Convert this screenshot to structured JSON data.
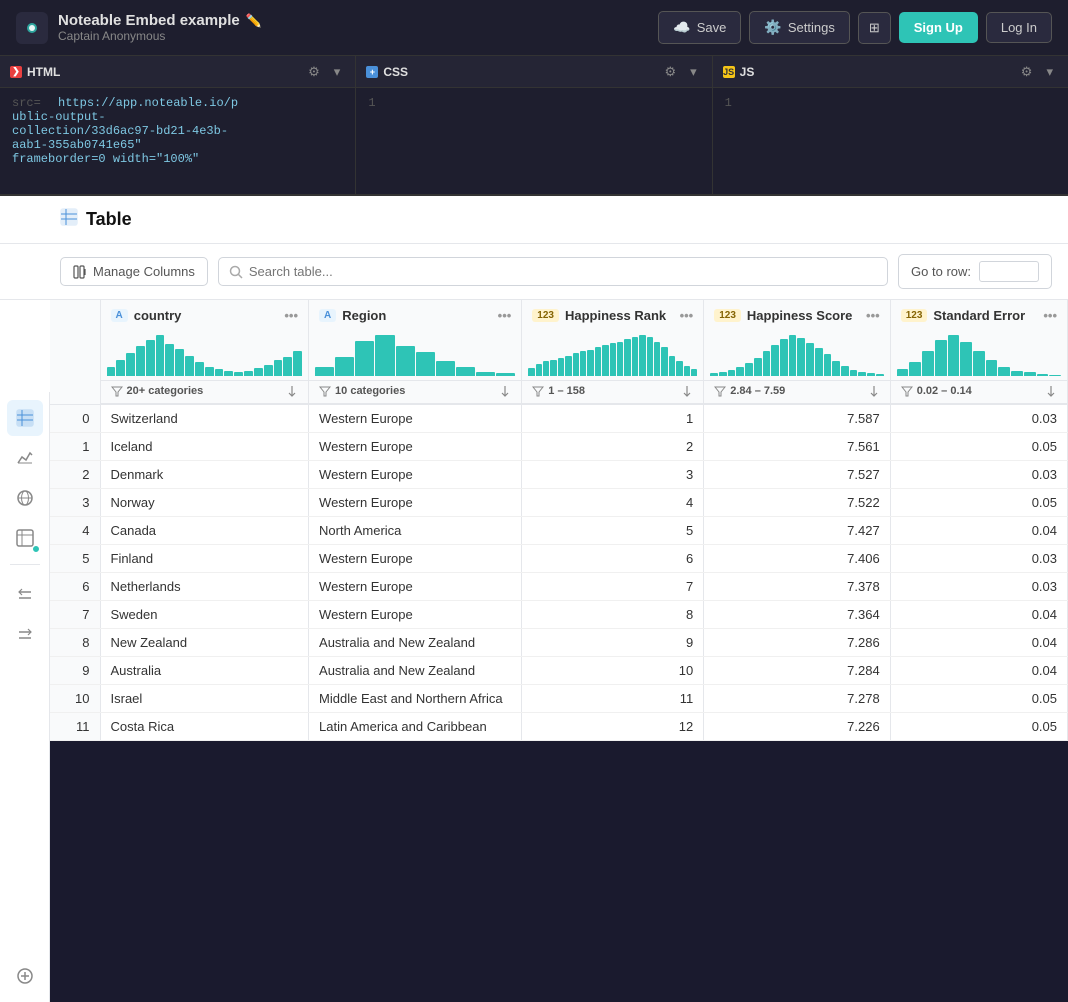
{
  "header": {
    "title": "Noteable Embed example",
    "subtitle": "Captain Anonymous",
    "buttons": {
      "save": "Save",
      "settings": "Settings",
      "signup": "Sign Up",
      "login": "Log In"
    }
  },
  "editor": {
    "panels": [
      {
        "lang": "HTML",
        "dot_type": "html",
        "lines": [
          "src= https://app.noteable.io/p",
          "ublic-output-",
          "collection/33d6ac97-bd21-4e3b-",
          "aab1-355ab0741e65\"",
          "frameborder=0 width=\"100%\""
        ]
      },
      {
        "lang": "CSS",
        "dot_type": "css",
        "lines": [
          "1"
        ]
      },
      {
        "lang": "JS",
        "dot_type": "js",
        "lines": [
          "1"
        ]
      }
    ]
  },
  "table": {
    "title": "Table",
    "manage_cols_label": "Manage Columns",
    "search_placeholder": "Search table...",
    "goto_row_label": "Go to row:",
    "columns": [
      {
        "type": "A",
        "name": "country",
        "type_class": "text",
        "stats": "20+ categories"
      },
      {
        "type": "A",
        "name": "Region",
        "type_class": "text",
        "stats": "10 categories"
      },
      {
        "type": "123",
        "name": "Happiness Rank",
        "type_class": "num",
        "stats": "1 – 158"
      },
      {
        "type": "123",
        "name": "Happiness Score",
        "type_class": "num",
        "stats": "2.84 – 7.59"
      },
      {
        "type": "123",
        "name": "Standard Error",
        "type_class": "num",
        "stats": "0.02 – 0.14"
      }
    ],
    "rows": [
      {
        "index": 0,
        "country": "Switzerland",
        "region": "Western Europe",
        "rank": 1,
        "score": 7.587,
        "stderr": 0.03
      },
      {
        "index": 1,
        "country": "Iceland",
        "region": "Western Europe",
        "rank": 2,
        "score": 7.561,
        "stderr": 0.05
      },
      {
        "index": 2,
        "country": "Denmark",
        "region": "Western Europe",
        "rank": 3,
        "score": 7.527,
        "stderr": 0.03
      },
      {
        "index": 3,
        "country": "Norway",
        "region": "Western Europe",
        "rank": 4,
        "score": 7.522,
        "stderr": 0.05
      },
      {
        "index": 4,
        "country": "Canada",
        "region": "North America",
        "rank": 5,
        "score": 7.427,
        "stderr": 0.04
      },
      {
        "index": 5,
        "country": "Finland",
        "region": "Western Europe",
        "rank": 6,
        "score": 7.406,
        "stderr": 0.03
      },
      {
        "index": 6,
        "country": "Netherlands",
        "region": "Western Europe",
        "rank": 7,
        "score": 7.378,
        "stderr": 0.03
      },
      {
        "index": 7,
        "country": "Sweden",
        "region": "Western Europe",
        "rank": 8,
        "score": 7.364,
        "stderr": 0.04
      },
      {
        "index": 8,
        "country": "New Zealand",
        "region": "Australia and New Zealand",
        "rank": 9,
        "score": 7.286,
        "stderr": 0.04
      },
      {
        "index": 9,
        "country": "Australia",
        "region": "Australia and New Zealand",
        "rank": 10,
        "score": 7.284,
        "stderr": 0.04
      },
      {
        "index": 10,
        "country": "Israel",
        "region": "Middle East and Northern Africa",
        "rank": 11,
        "score": 7.278,
        "stderr": 0.05
      },
      {
        "index": 11,
        "country": "Costa Rica",
        "region": "Latin America and Caribbean",
        "rank": 12,
        "score": 7.226,
        "stderr": 0.05
      }
    ],
    "histograms": {
      "country": [
        20,
        35,
        50,
        65,
        80,
        90,
        70,
        60,
        45,
        30,
        20,
        15,
        10,
        8,
        12,
        18,
        25,
        35,
        42,
        55
      ],
      "region": [
        20,
        45,
        80,
        95,
        70,
        55,
        35,
        20,
        10,
        8
      ],
      "rank": [
        10,
        15,
        18,
        20,
        22,
        25,
        28,
        30,
        32,
        35,
        38,
        40,
        42,
        45,
        48,
        50,
        48,
        42,
        35,
        25,
        18,
        12,
        8
      ],
      "score": [
        5,
        8,
        12,
        18,
        25,
        35,
        48,
        60,
        72,
        80,
        75,
        65,
        55,
        42,
        30,
        20,
        12,
        8,
        5,
        3
      ],
      "stderr": [
        15,
        30,
        55,
        80,
        90,
        75,
        55,
        35,
        20,
        12,
        8,
        5,
        3
      ]
    }
  },
  "sidebar": {
    "items": [
      {
        "icon": "📊",
        "name": "table-view"
      },
      {
        "icon": "📈",
        "name": "chart-view"
      },
      {
        "icon": "🌐",
        "name": "globe-view"
      },
      {
        "icon": "📋",
        "name": "data-view"
      }
    ]
  },
  "colors": {
    "teal": "#2ec4b6",
    "primary_bg": "#1e1e2e",
    "accent": "#4a90d9"
  }
}
